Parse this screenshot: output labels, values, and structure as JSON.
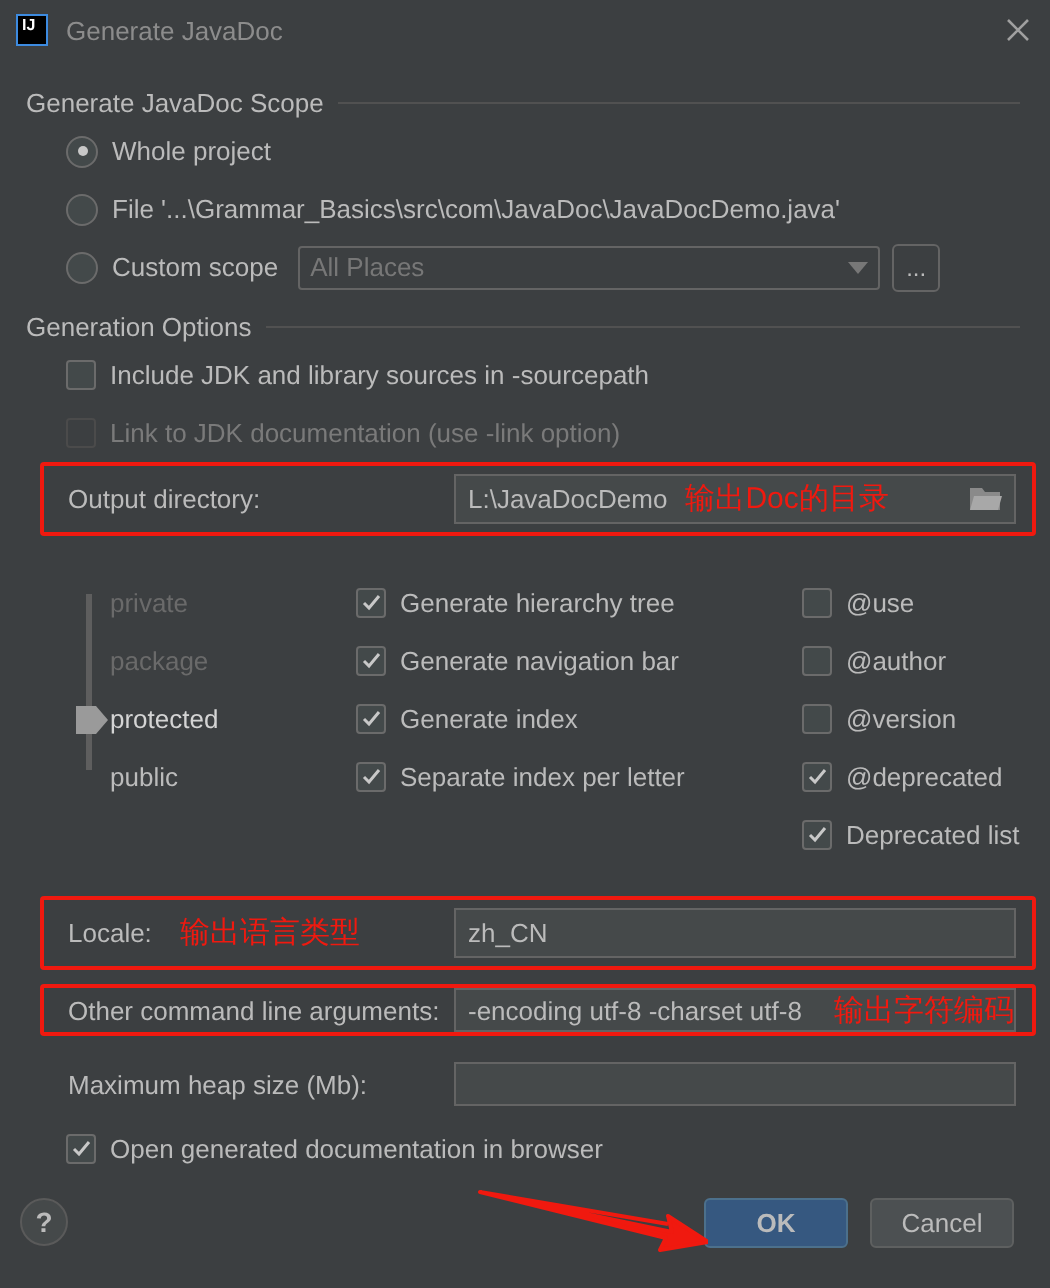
{
  "window": {
    "icon_label": "IJ",
    "title": "Generate JavaDoc"
  },
  "scope": {
    "title": "Generate JavaDoc Scope",
    "options": [
      {
        "label": "Whole project",
        "selected": true
      },
      {
        "label": "File '...\\Grammar_Basics\\src\\com\\JavaDoc\\JavaDocDemo.java'",
        "selected": false
      },
      {
        "label": "Custom scope",
        "selected": false
      }
    ],
    "custom_scope": {
      "value": "All Places",
      "disabled": true
    },
    "browse_button": "..."
  },
  "options": {
    "title": "Generation Options",
    "checkboxes": [
      {
        "label": "Include JDK and library sources in -sourcepath",
        "checked": false,
        "disabled": false
      },
      {
        "label": "Link to JDK documentation (use -link option)",
        "checked": false,
        "disabled": true
      }
    ],
    "output_directory": {
      "label": "Output directory:",
      "value": "L:\\JavaDocDemo",
      "highlighted": true,
      "field_note": "输出Doc的目录"
    },
    "visibility": {
      "levels": [
        {
          "label": "private",
          "selected": false
        },
        {
          "label": "package",
          "selected": false
        },
        {
          "label": "protected",
          "selected": true
        },
        {
          "label": "public",
          "selected": false
        }
      ]
    },
    "generate": [
      {
        "label": "Generate hierarchy tree",
        "checked": true
      },
      {
        "label": "Generate navigation bar",
        "checked": true
      },
      {
        "label": "Generate index",
        "checked": true
      },
      {
        "label": "Separate index per letter",
        "checked": true
      }
    ],
    "tags": [
      {
        "label": "@use",
        "checked": false
      },
      {
        "label": "@author",
        "checked": false
      },
      {
        "label": "@version",
        "checked": false
      },
      {
        "label": "@deprecated",
        "checked": true
      },
      {
        "label": "Deprecated list",
        "checked": true
      }
    ],
    "locale": {
      "label": "Locale:",
      "value": "zh_CN",
      "highlighted": true,
      "label_note": "输出语言类型"
    },
    "other_arguments": {
      "label": "Other command line arguments:",
      "value": "-encoding utf-8 -charset utf-8",
      "highlighted": true,
      "field_note": "输出字符编码"
    },
    "max_heap": {
      "label": "Maximum heap size (Mb):"
    },
    "open_in_browser": {
      "label": "Open generated documentation in browser",
      "checked": true
    }
  },
  "help_button": "?",
  "buttons": [
    {
      "label": "OK",
      "default": true
    },
    {
      "label": "Cancel",
      "default": false
    }
  ],
  "annotation_arrow": true
}
